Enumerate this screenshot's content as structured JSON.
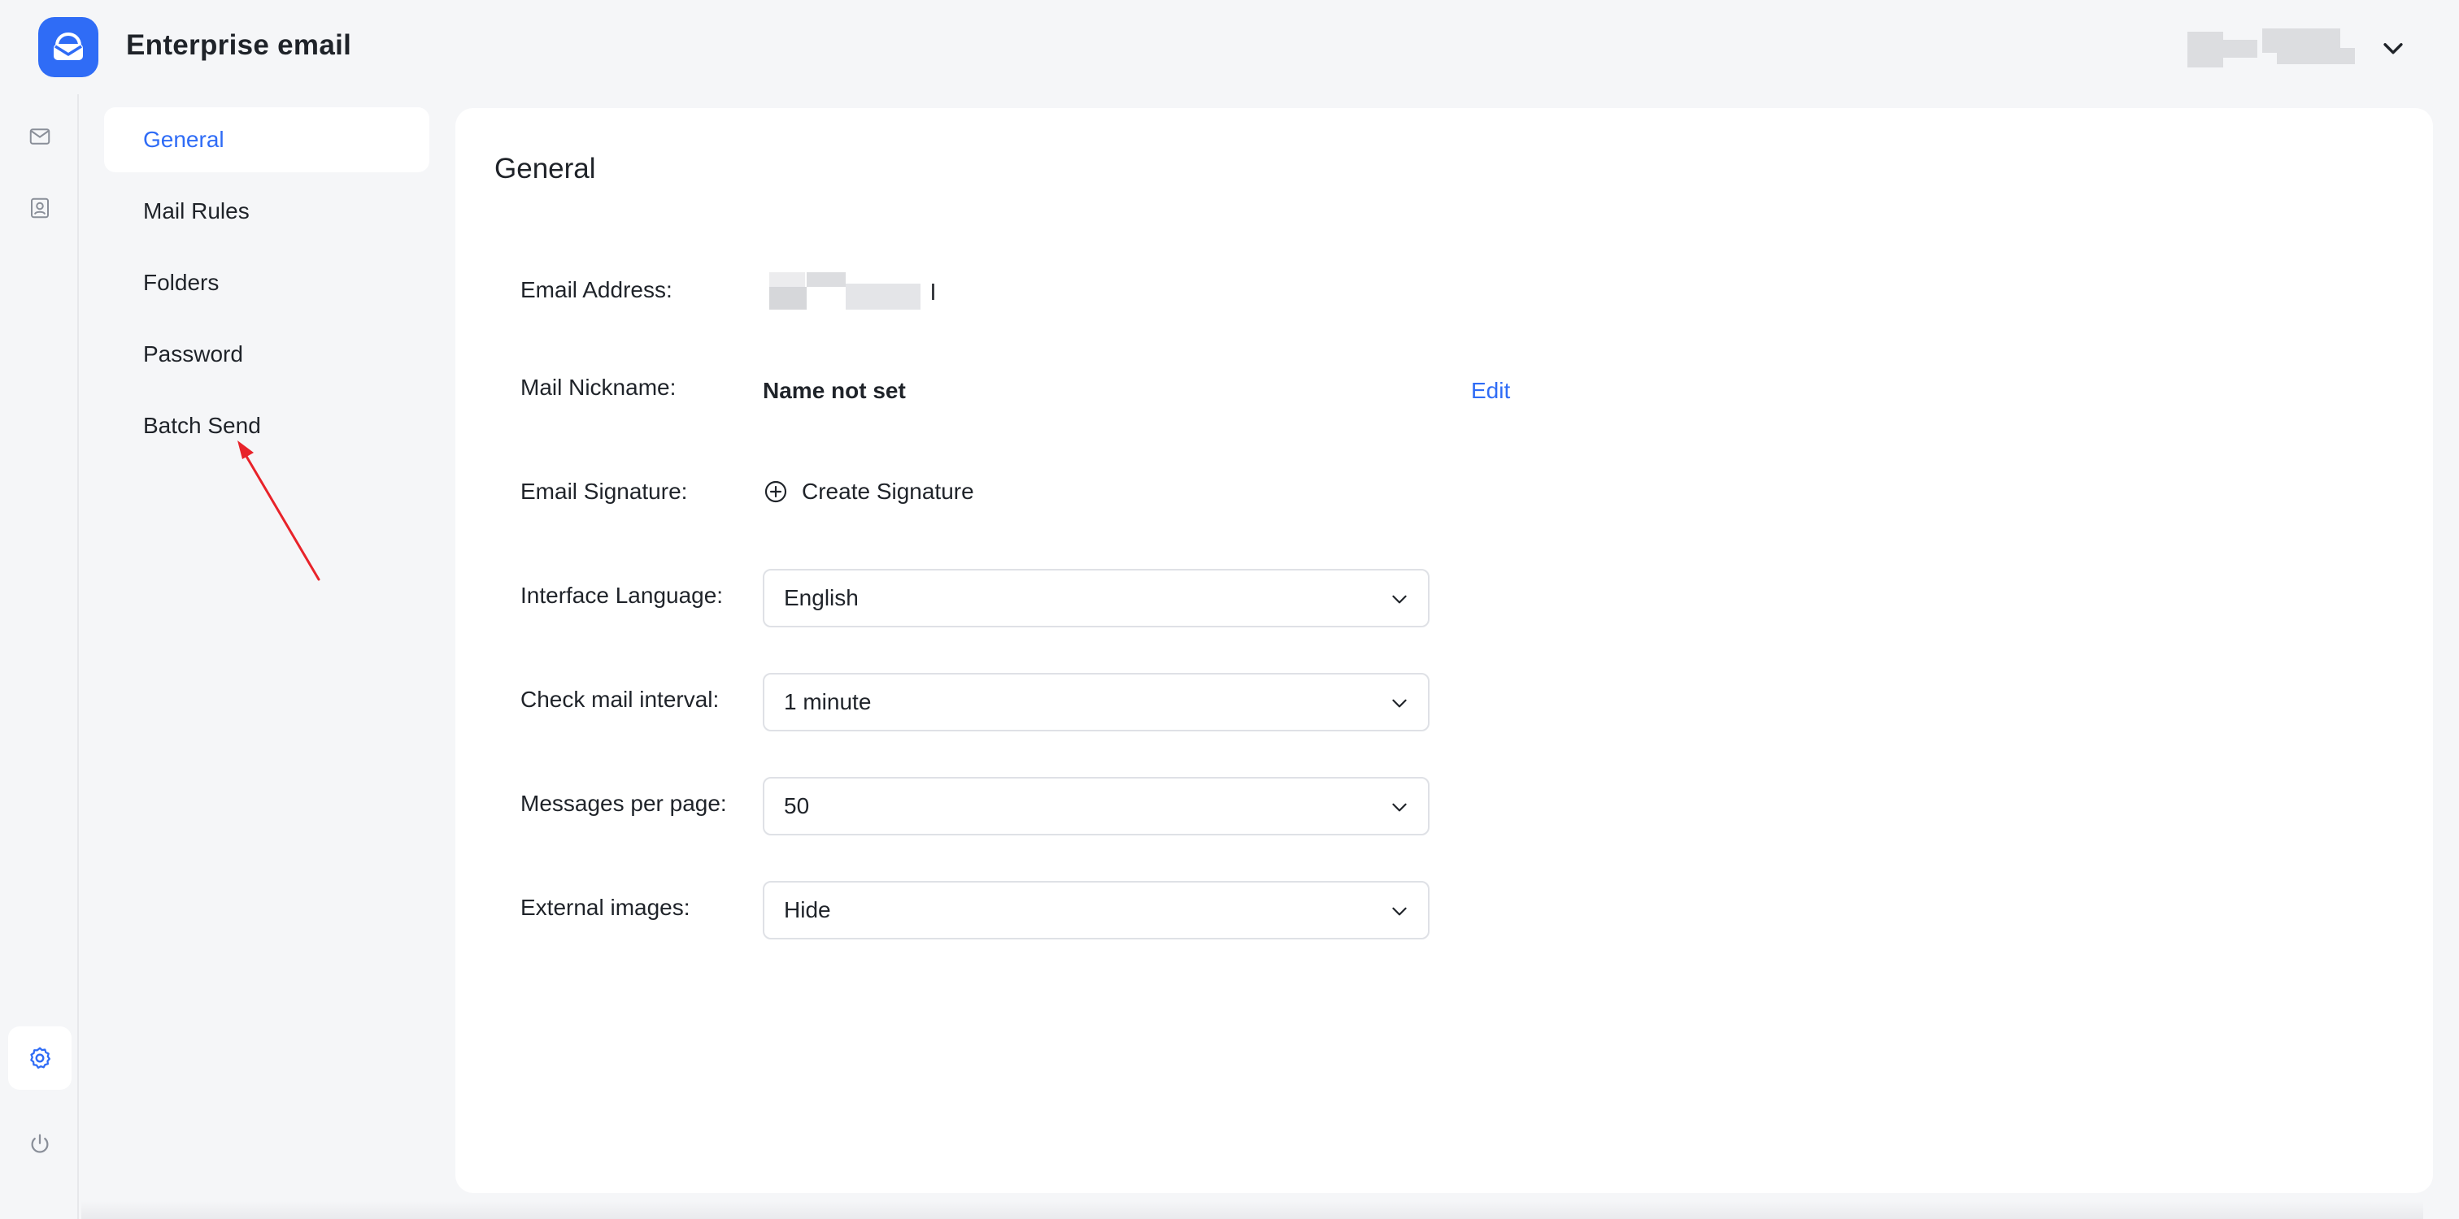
{
  "app": {
    "title": "Enterprise email",
    "logo_icon": "mail-cloud-logo-icon",
    "accent_color": "#2f6cf6"
  },
  "header": {
    "user_menu_icon": "chevron-down-icon"
  },
  "rail": {
    "items": [
      {
        "icon": "mail-icon"
      },
      {
        "icon": "contacts-icon"
      },
      {
        "icon": "gear-icon",
        "active": true
      },
      {
        "icon": "power-icon"
      }
    ]
  },
  "settings_nav": {
    "items": [
      {
        "label": "General",
        "active": true
      },
      {
        "label": "Mail Rules"
      },
      {
        "label": "Folders"
      },
      {
        "label": "Password"
      },
      {
        "label": "Batch Send"
      }
    ]
  },
  "general": {
    "title": "General",
    "email_address_label": "Email Address:",
    "mail_nickname_label": "Mail Nickname:",
    "mail_nickname_value": "Name not set",
    "edit_label": "Edit",
    "email_signature_label": "Email Signature:",
    "create_signature_label": "Create Signature",
    "interface_language_label": "Interface Language:",
    "interface_language_value": "English",
    "check_mail_interval_label": "Check mail interval:",
    "check_mail_interval_value": "1 minute",
    "messages_per_page_label": "Messages per page:",
    "messages_per_page_value": "50",
    "external_images_label": "External images:",
    "external_images_value": "Hide"
  }
}
